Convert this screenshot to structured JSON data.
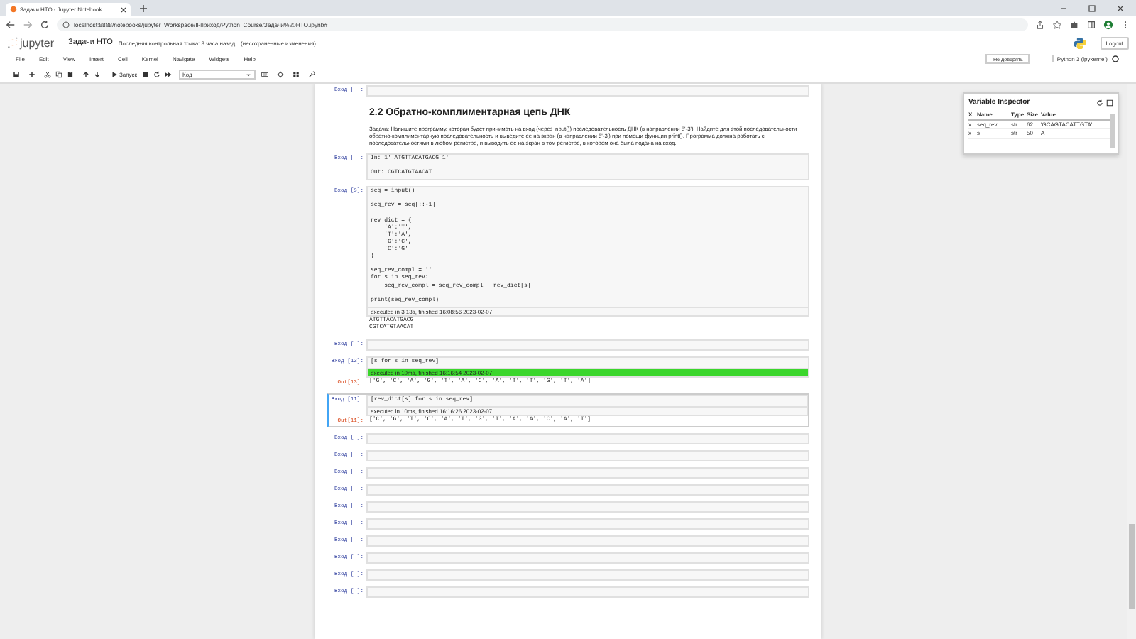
{
  "browser": {
    "tab_title": "Задачи НТО - Jupyter Notebook",
    "url": "localhost:8888/notebooks/jupyter_Workspace/Il-приход/Python_Course/Задачи%20НТО.ipynb#"
  },
  "header": {
    "logo": "jupyter",
    "title": "Задачи НТО",
    "checkpoint": "Последняя контрольная точка: 3 часа назад",
    "unsaved": "(несохраненные изменения)",
    "logout": "Logout"
  },
  "menu": [
    "File",
    "Edit",
    "View",
    "Insert",
    "Cell",
    "Kernel",
    "Navigate",
    "Widgets",
    "Help"
  ],
  "toolbar": {
    "run": "Запуск",
    "cell_type": "Код",
    "trust": "Не доверять",
    "kernel": "Python 3 (ipykernel)"
  },
  "cells": [
    {
      "kind": "code",
      "prompt": "Вход [ ]:",
      "selected": false
    },
    {
      "kind": "markdown",
      "heading": "2.2  Обратно-комплиментарная цепь ДНК",
      "text": "Задача: Напишите программу, которая будет принимать на вход (через input()) последовательность ДНК (в направлении 5'-3'). Найдите для этой последовательности обратно-комплиментарную последовательность и выведите ее на экран (в направлении 5'-3') при помощи функции print(). Программа должна работать с последовательностями в любом регистре, и выводить ее на экран в том регистре, в котором она была подана на вход."
    },
    {
      "kind": "raw",
      "prompt": "Вход [ ]:",
      "selected": false,
      "blocks": [
        [
          "In: 1' ATGTTACATGACG 1'"
        ],
        [
          "Out: CGTCATGTAACAT"
        ]
      ]
    },
    {
      "kind": "code",
      "prompt": "Вход [9]:",
      "selected": false,
      "blocks": [
        [
          "seq = input()"
        ],
        [
          "seq_rev = seq[::-1]"
        ],
        [
          "rev_dict = {",
          "    'A':'T',",
          "    'T':'A',",
          "    'G':'C',",
          "    'C':'G'",
          "}"
        ],
        [
          "seq_rev_compl = ''",
          "for s in seq_rev:",
          "    seq_rev_compl = seq_rev_compl + rev_dict[s]"
        ],
        [
          "print(seq_rev_compl)"
        ]
      ],
      "exec_info": "executed in 3.13s, finished 16:08:56 2023-02-07",
      "exec_highlight": false,
      "output": [
        "ATGTTACATGACG",
        "CGTCATGTAACAT"
      ]
    },
    {
      "kind": "code",
      "prompt": "Вход [ ]:",
      "selected": false
    },
    {
      "kind": "code",
      "prompt": "Вход [13]:",
      "selected": false,
      "blocks": [
        [
          "[s for s in seq_rev]"
        ]
      ],
      "exec_info": "executed in 10ms, finished 16:16:54 2023-02-07",
      "exec_highlight": true,
      "out_prompt": "Out[13]:",
      "output": [
        "['G', 'C', 'A', 'G', 'T', 'A', 'C', 'A', 'T', 'T', 'G', 'T', 'A']"
      ]
    },
    {
      "kind": "code",
      "prompt": "Вход [11]:",
      "selected": true,
      "blocks": [
        [
          "[rev_dict[s] for s in seq_rev]"
        ]
      ],
      "exec_info": "executed in 10ms, finished 16:16:26 2023-02-07",
      "exec_highlight": false,
      "out_prompt": "Out[11]:",
      "output": [
        "['C', 'G', 'T', 'C', 'A', 'T', 'G', 'T', 'A', 'A', 'C', 'A', 'T']"
      ]
    },
    {
      "kind": "code",
      "prompt": "Вход [ ]:",
      "selected": false
    },
    {
      "kind": "code",
      "prompt": "Вход [ ]:",
      "selected": false
    },
    {
      "kind": "code",
      "prompt": "Вход [ ]:",
      "selected": false
    },
    {
      "kind": "code",
      "prompt": "Вход [ ]:",
      "selected": false
    },
    {
      "kind": "code",
      "prompt": "Вход [ ]:",
      "selected": false
    },
    {
      "kind": "code",
      "prompt": "Вход [ ]:",
      "selected": false
    },
    {
      "kind": "code",
      "prompt": "Вход [ ]:",
      "selected": false
    },
    {
      "kind": "code",
      "prompt": "Вход [ ]:",
      "selected": false
    },
    {
      "kind": "code",
      "prompt": "Вход [ ]:",
      "selected": false
    },
    {
      "kind": "code",
      "prompt": "Вход [ ]:",
      "selected": false
    }
  ],
  "variable_inspector": {
    "title": "Variable Inspector",
    "columns": [
      "X",
      "Name",
      "Type",
      "Size",
      "Value"
    ],
    "rows": [
      [
        "x",
        "seq_rev",
        "str",
        "62",
        "'GCAGTACATTGTA'"
      ],
      [
        "x",
        "s",
        "str",
        "50",
        "A"
      ]
    ]
  }
}
